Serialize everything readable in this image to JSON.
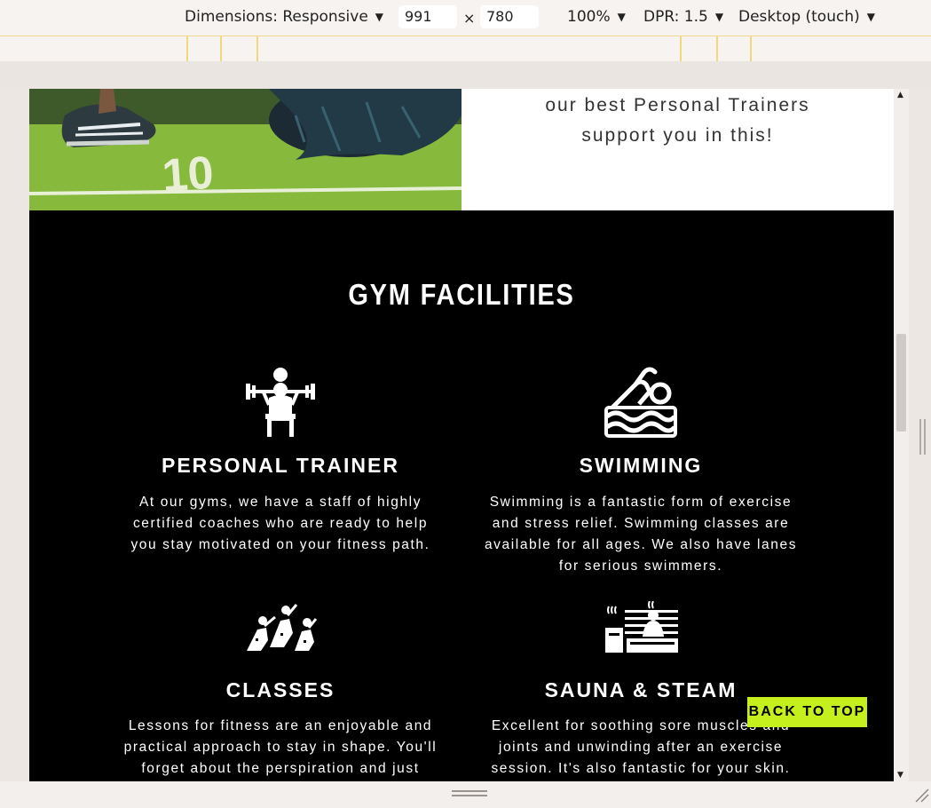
{
  "toolbar": {
    "dimensions_label": "Dimensions: Responsive",
    "width_value": "991",
    "times_sign": "×",
    "height_value": "780",
    "zoom": "100%",
    "dpr": "DPR: 1.5",
    "device_mode": "Desktop (touch)"
  },
  "hero": {
    "text_line1": "our best Personal Trainers",
    "text_line2": "support you in this!"
  },
  "facilities": {
    "title": "GYM FACILITIES",
    "cards": [
      {
        "title": "PERSONAL TRAINER",
        "lines": [
          "At our gyms, we have a staff of highly",
          "certified coaches who are ready to help",
          "you stay motivated on your fitness path."
        ],
        "icon": "weightlifting-icon"
      },
      {
        "title": "SWIMMING",
        "lines": [
          "Swimming is a fantastic form of exercise",
          "and stress relief. Swimming classes are",
          "available for all ages. We also have lanes",
          "for serious swimmers."
        ],
        "icon": "swimmer-icon"
      },
      {
        "title": "CLASSES",
        "lines": [
          "Lessons for fitness are an enjoyable and",
          "practical approach to stay in shape. You'll",
          "forget about the perspiration and just"
        ],
        "icon": "rowing-class-icon"
      },
      {
        "title": "SAUNA & STEAM",
        "lines": [
          "Excellent for soothing sore muscles and",
          "joints and unwinding after an exercise",
          "session. It's also fantastic for your skin."
        ],
        "icon": "sauna-icon"
      }
    ]
  },
  "back_to_top": "BACK TO TOP",
  "colors": {
    "accent": "#c6f01d",
    "section_bg": "#000000"
  }
}
